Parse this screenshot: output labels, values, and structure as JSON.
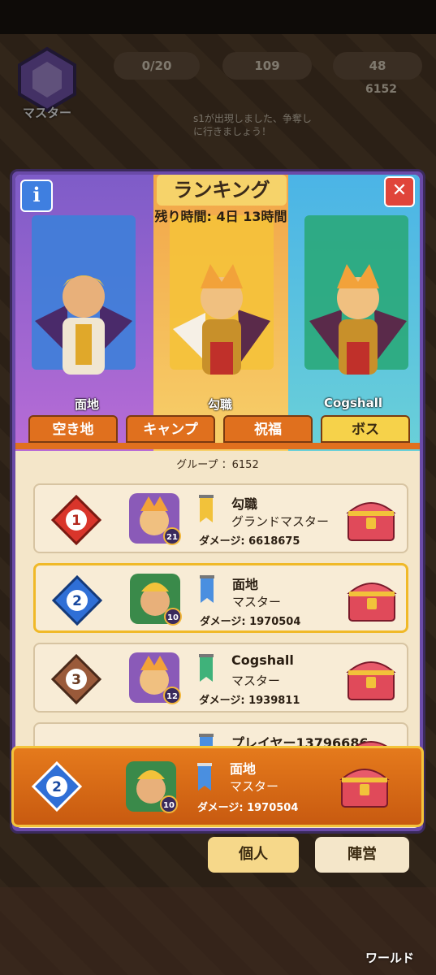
{
  "top": {
    "master_label": "マスター",
    "stats": [
      "0/20",
      "109",
      "48",
      "6152"
    ],
    "notice": "s1が出現しました、争奪しに行きましょう！"
  },
  "panel": {
    "title": "ランキング",
    "timer": "残り時間: 4日 13時間",
    "heroes": [
      {
        "name": "面地"
      },
      {
        "name": "勾職"
      },
      {
        "name": "Cogshall"
      }
    ],
    "tabs": [
      "空き地",
      "キャンプ",
      "祝福",
      "ボス"
    ],
    "active_tab": "ボス",
    "group": "グループ ：6152",
    "rows": [
      {
        "rank": "1",
        "name": "勾職",
        "title": "グランドマスター",
        "damage": "ダメージ: 6618675",
        "level": "21",
        "rank_color": "#d9352b",
        "flag_color": "#f2c23a"
      },
      {
        "rank": "2",
        "name": "面地",
        "title": "マスター",
        "damage": "ダメージ: 1970504",
        "level": "10",
        "rank_color": "#2f6fd6",
        "flag_color": "#4a8fe0"
      },
      {
        "rank": "3",
        "name": "Cogshall",
        "title": "マスター",
        "damage": "ダメージ: 1939811",
        "level": "12",
        "rank_color": "#9a5a3a",
        "flag_color": "#3fb27a"
      },
      {
        "rank": "",
        "name": "プレイヤー13796686",
        "title": "",
        "damage": "",
        "level": "",
        "rank_color": "#c9a66a",
        "flag_color": "#4a8fe0"
      }
    ],
    "me": {
      "rank": "2",
      "name": "面地",
      "title": "マスター",
      "damage": "ダメージ: 1970504",
      "level": "10"
    }
  },
  "buttons": {
    "personal": "個人",
    "camp": "陣営"
  },
  "nav": {
    "world": "ワールド"
  }
}
